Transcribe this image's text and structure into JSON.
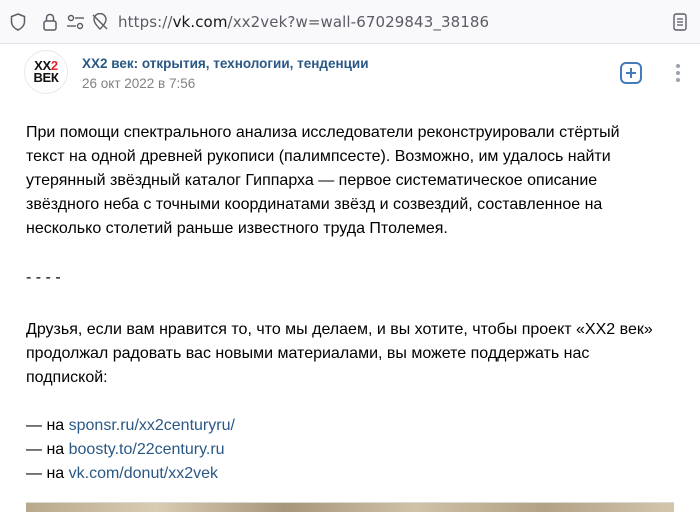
{
  "browser": {
    "url_prefix": "https://",
    "url_host": "vk.com",
    "url_path": "/xx2vek?w=wall-67029843_38186"
  },
  "post": {
    "avatar_line1_a": "XX",
    "avatar_line1_b": "2",
    "avatar_line2": "ВЕК",
    "author": "XX2 век: открытия, технологии, тенденции",
    "date": "26 окт 2022 в 7:56",
    "paragraph1": [
      "При помощи спектрального анализа исследователи реконструировали стёртый",
      "текст на одной древней рукописи (палимпсесте). Возможно, им удалось найти",
      "утерянный звёздный каталог Гиппарха — первое систематическое описание",
      "звёздного неба с точными координатами звёзд и созвездий, составленное на",
      "несколько столетий раньше известного труда Птолемея."
    ],
    "separator": "- - - -",
    "paragraph2": [
      "Друзья, если вам нравится то, что мы делаем, и вы хотите, чтобы проект «XX2 век»",
      "продолжал радовать вас новыми материалами, вы можете поддержать нас",
      "подпиской:"
    ],
    "links": [
      {
        "prefix": "— на ",
        "text": "sponsr.ru/xx2centuryru/"
      },
      {
        "prefix": "— на ",
        "text": "boosty.to/22century.ru"
      },
      {
        "prefix": "— на ",
        "text": "vk.com/donut/xx2vek"
      }
    ]
  },
  "icons": [
    "shield-icon",
    "permissions-icon",
    "tracking-off-icon",
    "reader-view-icon",
    "add-icon",
    "more-icon"
  ],
  "colors": {
    "link": "#2a5885",
    "author": "#2a5885",
    "date": "#828282",
    "accent": "#447bba",
    "logo_red": "#e3262f"
  }
}
